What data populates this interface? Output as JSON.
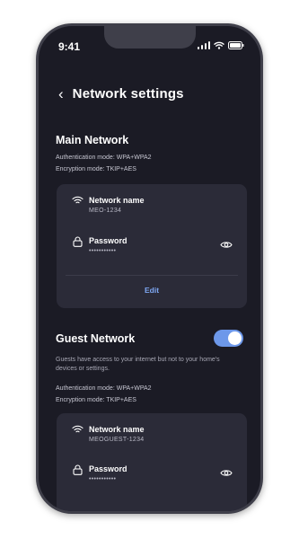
{
  "status_bar": {
    "time": "9:41"
  },
  "header": {
    "back_label": "‹",
    "title": "Network settings"
  },
  "main_network": {
    "title": "Main Network",
    "auth_mode": "Authentication mode: WPA+WPA2",
    "encryption_mode": "Encryption mode: TKIP+AES",
    "network_name_label": "Network name",
    "network_name_value": "MEO-1234",
    "password_label": "Password",
    "password_value": "•••••••••••",
    "edit_label": "Edit"
  },
  "guest_network": {
    "title": "Guest Network",
    "enabled": true,
    "description": "Guests have access to your internet but not to your home's devices or settings.",
    "auth_mode": "Authentication mode: WPA+WPA2",
    "encryption_mode": "Encryption mode: TKIP+AES",
    "network_name_label": "Network name",
    "network_name_value": "MEOGUEST-1234",
    "password_label": "Password",
    "password_value": "•••••••••••"
  },
  "colors": {
    "background": "#1b1b25",
    "card": "#2b2b38",
    "accent": "#6d98ea",
    "link": "#7ea7f2"
  },
  "icons": [
    "wifi-icon",
    "lock-icon",
    "eye-icon",
    "chevron-left-icon",
    "signal-icon",
    "battery-icon"
  ]
}
